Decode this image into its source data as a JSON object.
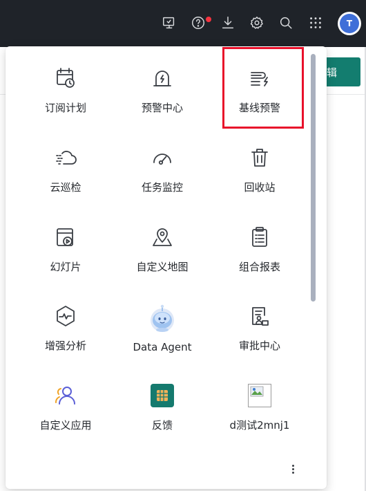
{
  "topbar": {
    "icons": [
      "monitor-icon",
      "help-icon",
      "download-icon",
      "settings-icon",
      "search-icon",
      "apps-grid-icon"
    ],
    "notification_dot_color": "#f5333f",
    "avatar_text": "T"
  },
  "background": {
    "edit_button_label": "辑",
    "accent_color": "#137d6f"
  },
  "apps": [
    {
      "label": "订阅计划",
      "icon": "calendar-clock-icon"
    },
    {
      "label": "预警中心",
      "icon": "alarm-bell-icon"
    },
    {
      "label": "基线预警",
      "icon": "baseline-alert-icon"
    },
    {
      "label": "云巡检",
      "icon": "cloud-inspect-icon"
    },
    {
      "label": "任务监控",
      "icon": "gauge-icon"
    },
    {
      "label": "回收站",
      "icon": "trash-icon"
    },
    {
      "label": "幻灯片",
      "icon": "slideshow-icon"
    },
    {
      "label": "自定义地图",
      "icon": "map-pin-icon"
    },
    {
      "label": "组合报表",
      "icon": "clipboard-report-icon"
    },
    {
      "label": "增强分析",
      "icon": "hexagon-pulse-icon"
    },
    {
      "label": "Data Agent",
      "icon": "robot-avatar-icon"
    },
    {
      "label": "审批中心",
      "icon": "approval-doc-icon"
    },
    {
      "label": "自定义应用",
      "icon": "users-icon"
    },
    {
      "label": "反馈",
      "icon": "feedback-grid-icon"
    },
    {
      "label": "d测试2mnj1",
      "icon": "broken-image-icon"
    }
  ],
  "highlighted_app": "基线预警",
  "highlight_color": "#e8102a",
  "more_icon": "more-vertical-icon"
}
